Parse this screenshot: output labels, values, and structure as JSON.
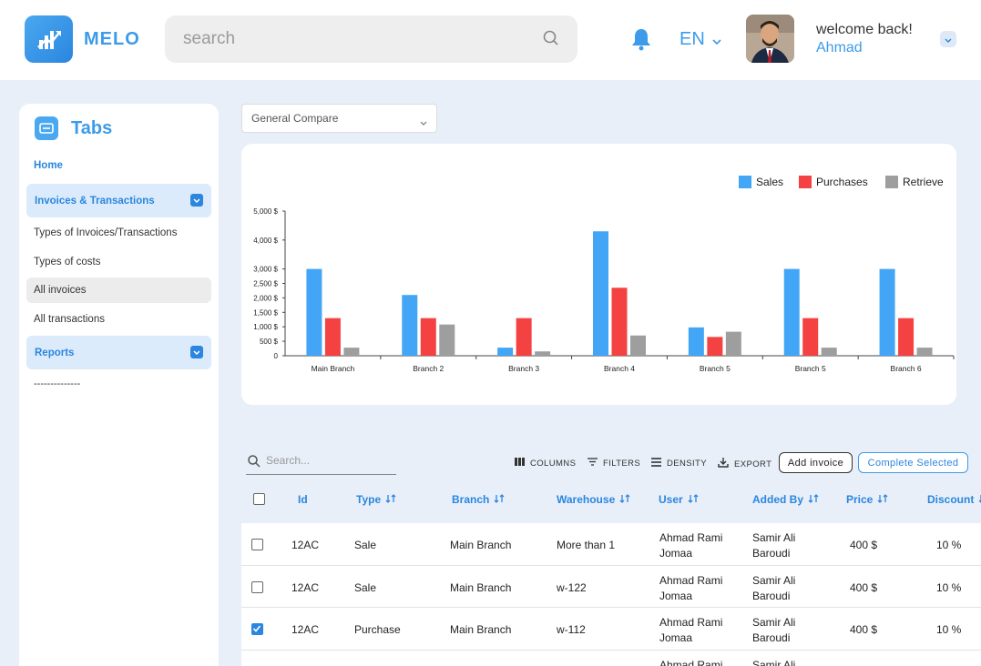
{
  "header": {
    "brand": "MELO",
    "search_placeholder": "search",
    "language": "EN",
    "welcome": "welcome back!",
    "username": "Ahmad"
  },
  "sidebar": {
    "title": "Tabs",
    "home": "Home",
    "group_invoices": "Invoices & Transactions",
    "items": [
      "Types of Invoices/Transactions",
      "Types of costs",
      "All invoices",
      "All transactions"
    ],
    "group_reports": "Reports",
    "separator": "--------------"
  },
  "compare": {
    "selected": "General Compare"
  },
  "colors": {
    "accent": "#2a86df",
    "sales": "#42a5f5",
    "purchases": "#f44242",
    "retrieve": "#9e9e9e"
  },
  "chart_data": {
    "type": "bar",
    "categories": [
      "Main Branch",
      "Branch 2",
      "Branch 3",
      "Branch 4",
      "Branch 5",
      "Branch 5",
      "Branch 6"
    ],
    "series": [
      {
        "name": "Sales",
        "values": [
          3000,
          2100,
          280,
          4300,
          980,
          3000,
          3000
        ]
      },
      {
        "name": "Purchases",
        "values": [
          1300,
          1300,
          1300,
          2350,
          650,
          1300,
          1300
        ]
      },
      {
        "name": "Retrieve",
        "values": [
          280,
          1080,
          150,
          700,
          830,
          280,
          280
        ]
      }
    ],
    "yticks": [
      "0",
      "500 $",
      "1,000 $",
      "1,500 $",
      "2,000 $",
      "2,500 $",
      "3,000 $",
      "4,000 $",
      "5,000 $"
    ],
    "ylim": [
      0,
      5000
    ],
    "legend": "top-right",
    "grid": false
  },
  "table": {
    "search_placeholder": "Search...",
    "tools": {
      "columns": "COLUMNS",
      "filters": "FILTERS",
      "density": "DENSITY",
      "export": "EXPORT"
    },
    "add_button": "Add invoice",
    "complete_button": "Complete Selected",
    "columns": [
      "Id",
      "Type",
      "Branch",
      "Warehouse",
      "User",
      "Added By",
      "Price",
      "Discount"
    ],
    "rows": [
      {
        "checked": false,
        "id": "12AC",
        "type": "Sale",
        "branch": "Main Branch",
        "warehouse": "More than 1",
        "user": "Ahmad Rami Jomaa",
        "added_by": "Samir Ali Baroudi",
        "price": "400 $",
        "discount": "10 %"
      },
      {
        "checked": false,
        "id": "12AC",
        "type": "Sale",
        "branch": "Main Branch",
        "warehouse": "w-122",
        "user": "Ahmad Rami Jomaa",
        "added_by": "Samir Ali Baroudi",
        "price": "400 $",
        "discount": "10 %"
      },
      {
        "checked": true,
        "id": "12AC",
        "type": "Purchase",
        "branch": "Main Branch",
        "warehouse": "w-112",
        "user": "Ahmad Rami Jomaa",
        "added_by": "Samir Ali Baroudi",
        "price": "400 $",
        "discount": "10 %"
      },
      {
        "checked": false,
        "id": "",
        "type": "",
        "branch": "",
        "warehouse": "",
        "user": "Ahmad Rami",
        "added_by": "Samir Ali",
        "price": "",
        "discount": ""
      }
    ]
  }
}
